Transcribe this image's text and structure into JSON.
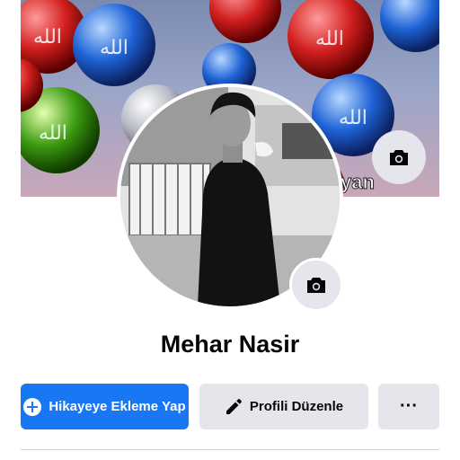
{
  "profile": {
    "name": "Mehar Nasir"
  },
  "cover": {
    "watermark_text": "yan",
    "bubble_text": "الله"
  },
  "actions": {
    "add_story_label": "Hikayeye Ekleme Yap",
    "edit_profile_label": "Profili Düzenle",
    "more_label": "···"
  },
  "icons": {
    "cover_camera": "camera-icon",
    "avatar_camera": "camera-icon",
    "add_story": "plus-circle-icon",
    "edit_profile": "pencil-icon",
    "more": "ellipsis-icon"
  },
  "colors": {
    "primary": "#1877f2",
    "secondary_bg": "#e4e6eb",
    "text": "#050505"
  }
}
